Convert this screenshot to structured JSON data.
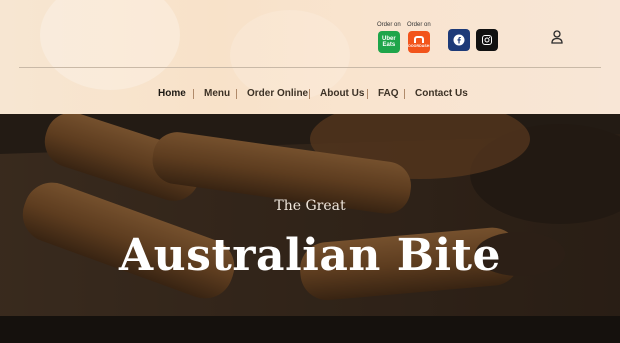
{
  "header": {
    "order_online": [
      {
        "label": "Order on",
        "service": "Uber Eats",
        "badge_lines": [
          "Uber",
          "Eats"
        ],
        "color": "#1fa54a"
      },
      {
        "label": "Order on",
        "service": "DoorDash",
        "badge_text": "DOORDASH",
        "color": "#f2541b"
      }
    ],
    "social": [
      {
        "icon": "facebook-icon",
        "color": "#1d3a78"
      },
      {
        "icon": "instagram-icon",
        "color": "#111111"
      }
    ],
    "account_icon": "user-icon"
  },
  "nav": {
    "items": [
      {
        "label": "Home",
        "active": true
      },
      {
        "label": "Menu"
      },
      {
        "label": "Order Online"
      },
      {
        "label": "About Us"
      },
      {
        "label": "FAQ"
      },
      {
        "label": "Contact Us"
      }
    ]
  },
  "hero": {
    "kicker": "The Great",
    "title": "Australian Bite"
  }
}
